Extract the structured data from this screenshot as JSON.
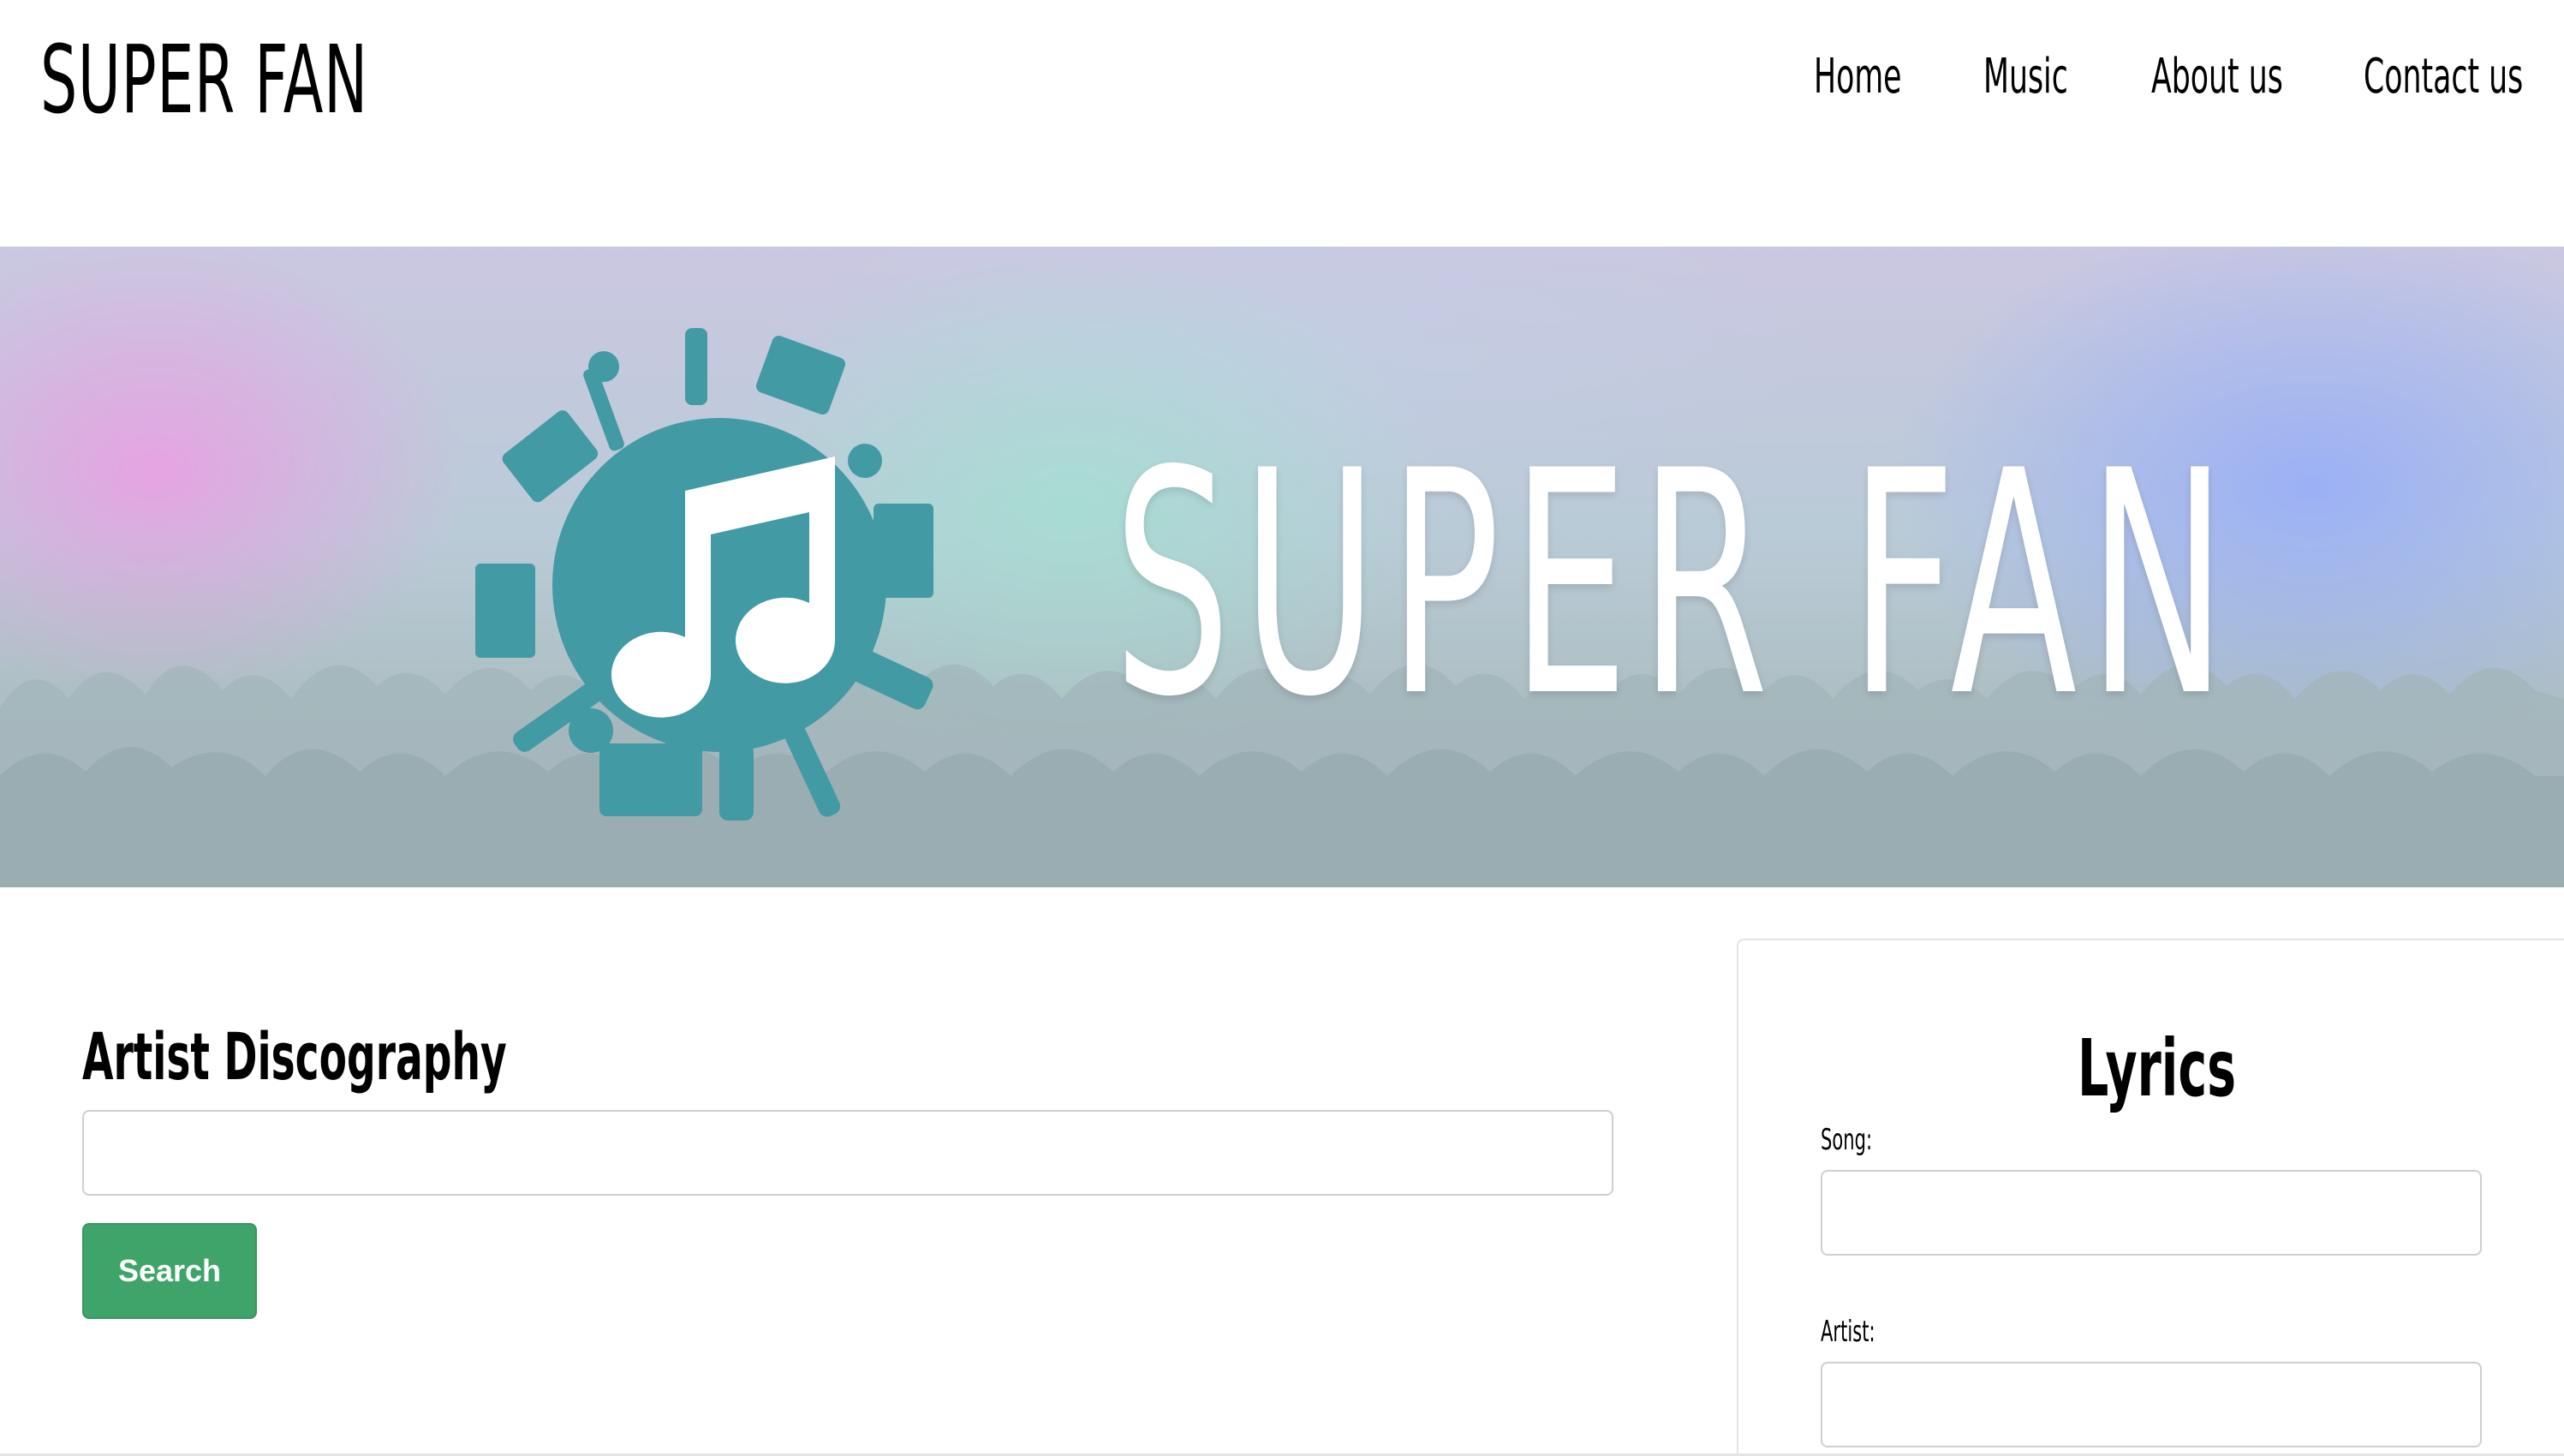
{
  "header": {
    "brand": "SUPER FAN",
    "nav": [
      {
        "label": "Home"
      },
      {
        "label": "Music"
      },
      {
        "label": "About us"
      },
      {
        "label": "Contact us"
      }
    ]
  },
  "hero": {
    "title": "SUPER FAN",
    "logo_icon": "music-note-icon",
    "logo_color": "#429aa5"
  },
  "discography": {
    "title": "Artist Discography",
    "input_value": "",
    "search_label": "Search",
    "button_color": "#3fa46a"
  },
  "lyrics": {
    "title": "Lyrics",
    "song_label": "Song:",
    "song_value": "",
    "artist_label": "Artist:",
    "artist_value": ""
  }
}
